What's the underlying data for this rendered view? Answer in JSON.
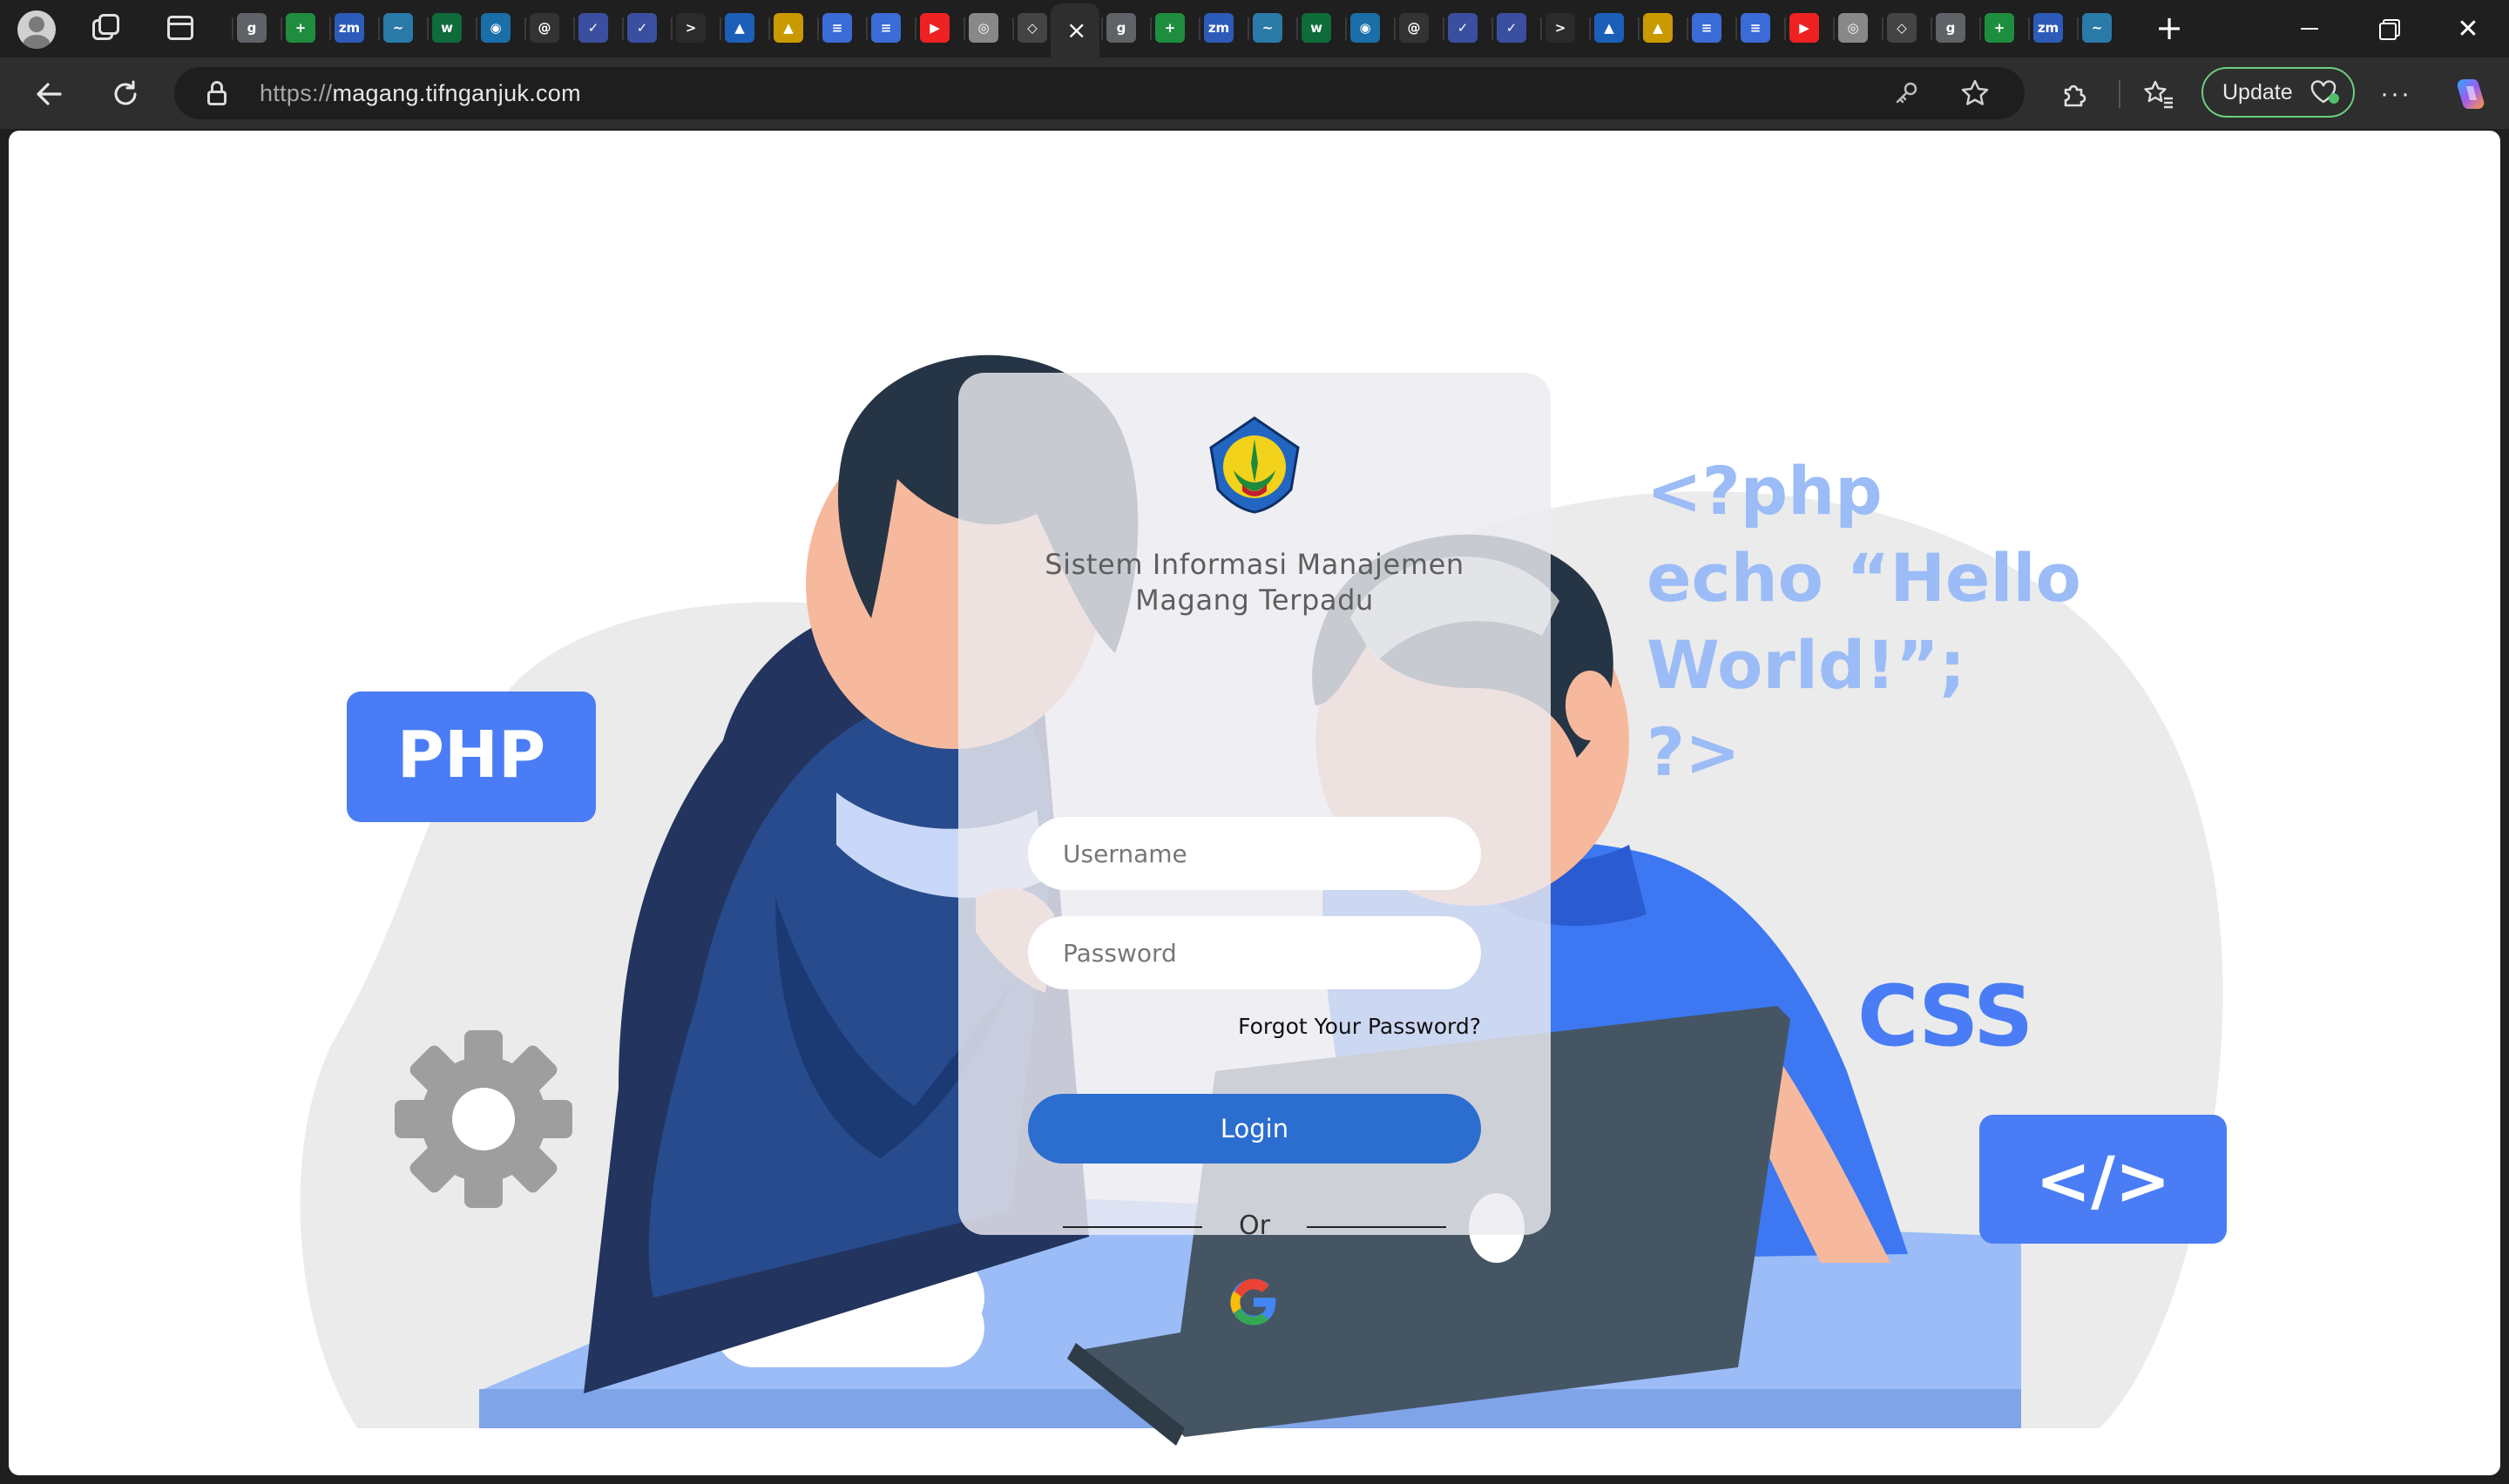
{
  "browser": {
    "address_scheme": "https://",
    "address_host": "magang.tifnganjuk.com",
    "update_label": "Update",
    "active_tab_close": "×",
    "pinned_tabs": [
      {
        "icon": "g-icon",
        "glyph": "g",
        "color": "#5f6368"
      },
      {
        "icon": "sheets-icon",
        "glyph": "+",
        "color": "#1e8e3e"
      },
      {
        "icon": "zoom-icon",
        "glyph": "zm",
        "color": "#2d5bb9"
      },
      {
        "icon": "tailwind-icon",
        "glyph": "~",
        "color": "#2a7aa8"
      },
      {
        "icon": "w-icon",
        "glyph": "w",
        "color": "#0e6b3a"
      },
      {
        "icon": "globe-icon",
        "glyph": "◉",
        "color": "#1b6fa8"
      },
      {
        "icon": "threads-icon",
        "glyph": "@",
        "color": "#333333"
      },
      {
        "icon": "bird-icon",
        "glyph": "✓",
        "color": "#3b4fa0"
      },
      {
        "icon": "bird-icon",
        "glyph": "✓",
        "color": "#3b4fa0"
      },
      {
        "icon": "terminal-icon",
        "glyph": ">",
        "color": "#2b2b2b"
      },
      {
        "icon": "cap-icon",
        "glyph": "▲",
        "color": "#1c5fb8"
      },
      {
        "icon": "drive-icon",
        "glyph": "▲",
        "color": "#c99a00"
      },
      {
        "icon": "docs-icon",
        "glyph": "≡",
        "color": "#3b6bd6"
      },
      {
        "icon": "docs-icon",
        "glyph": "≡",
        "color": "#3b6bd6"
      },
      {
        "icon": "youtube-icon",
        "glyph": "▶",
        "color": "#e22"
      },
      {
        "icon": "chrome-icon",
        "glyph": "◎",
        "color": "#888"
      },
      {
        "icon": "codepen-icon",
        "glyph": "◇",
        "color": "#444"
      }
    ]
  },
  "login": {
    "title_line1": "Sistem Informasi Manajemen",
    "title_line2": "Magang Terpadu",
    "username_placeholder": "Username",
    "password_placeholder": "Password",
    "forgot_label": "Forgot Your Password?",
    "login_label": "Login",
    "or_label": "Or",
    "google_icon": "google-icon"
  },
  "illustration": {
    "php_badge": "PHP",
    "css_text": "CSS",
    "code_badge": "</>",
    "code_line1": "<?php",
    "code_line2": "echo “Hello",
    "code_line3": "World!”;",
    "code_line4": "?>",
    "accent": "#4a7df5",
    "light_accent": "#9bbcf6"
  }
}
